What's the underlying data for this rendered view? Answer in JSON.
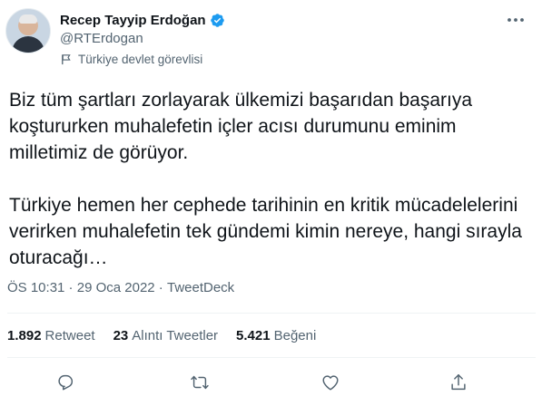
{
  "author": {
    "name": "Recep Tayyip Erdoğan",
    "handle": "@RTErdogan",
    "label": "Türkiye devlet görevlisi"
  },
  "tweet": {
    "text": "Biz tüm şartları zorlayarak ülkemizi başarıdan başarıya koştururken muhalefetin içler acısı durumunu eminim milletimiz de görüyor.\n\nTürkiye hemen her cephede tarihinin en kritik mücadelelerini verirken muhalefetin tek gündemi kimin nereye, hangi sırayla oturacağı…",
    "time": "ÖS 10:31",
    "separator": " · ",
    "date": "29 Oca 2022",
    "source": "TweetDeck"
  },
  "stats": {
    "retweets_count": "1.892",
    "retweets_label": "Retweet",
    "quotes_count": "23",
    "quotes_label": "Alıntı Tweetler",
    "likes_count": "5.421",
    "likes_label": "Beğeni"
  },
  "icons": {
    "verified": "verified-badge-icon",
    "label": "flag-icon",
    "more": "more-icon",
    "reply": "reply-icon",
    "retweet": "retweet-icon",
    "like": "like-icon",
    "share": "share-icon"
  },
  "colors": {
    "verified_blue": "#1d9bf0",
    "secondary_text": "#536471",
    "primary_text": "#0f1419"
  }
}
